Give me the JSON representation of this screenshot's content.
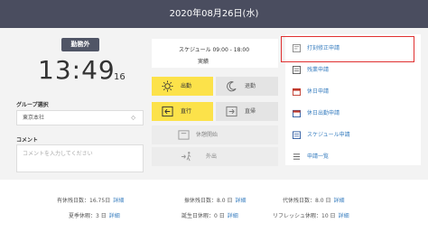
{
  "header": {
    "date": "2020年08月26日(水)"
  },
  "status": {
    "badge": "勤務外"
  },
  "clock": {
    "time": "13:49",
    "seconds": "16"
  },
  "group": {
    "label": "グループ選択",
    "value": "東京本社"
  },
  "comment": {
    "label": "コメント",
    "placeholder": "コメントを入力してください"
  },
  "schedule": {
    "title": "スケジュール 09:00 - 18:00",
    "status": "実績"
  },
  "buttons": {
    "clock_in": "出勤",
    "clock_out": "退勤",
    "direct_go": "直行",
    "direct_return": "直帰",
    "break_start": "休憩開始",
    "go_out": "外出"
  },
  "sidebar": {
    "items": [
      {
        "label": "打刻修正申請",
        "icon": "stamp-edit-icon"
      },
      {
        "label": "残業申請",
        "icon": "overtime-icon"
      },
      {
        "label": "休日申請",
        "icon": "holiday-icon"
      },
      {
        "label": "休日出勤申請",
        "icon": "holiday-work-icon"
      },
      {
        "label": "スケジュール申請",
        "icon": "schedule-icon"
      },
      {
        "label": "申請一覧",
        "icon": "list-icon"
      }
    ]
  },
  "footer": {
    "stats": [
      {
        "label": "有休残日数：",
        "value": "16.75日",
        "link": "詳細"
      },
      {
        "label": "振休残日数：",
        "value": "8.0 日",
        "link": "詳細"
      },
      {
        "label": "代休残日数：",
        "value": "8.0 日",
        "link": "詳細"
      },
      {
        "label": "夏季休暇：",
        "value": "3 日",
        "link": "詳細"
      },
      {
        "label": "誕生日休暇：",
        "value": "0 日",
        "link": "詳細"
      },
      {
        "label": "リフレッシュ休暇：",
        "value": "10 日",
        "link": "詳細"
      }
    ]
  }
}
